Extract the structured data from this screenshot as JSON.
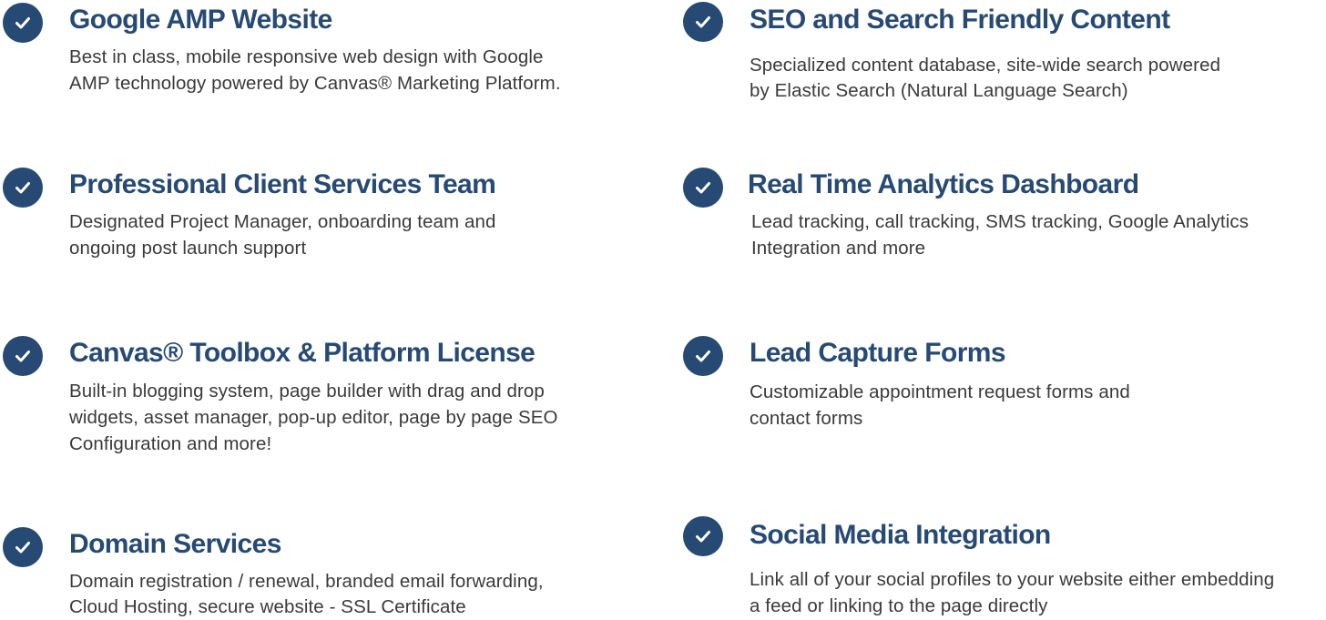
{
  "brand": {
    "accent": "#264a73",
    "text": "#3a3a3a",
    "check_icon": "checkmark-circle-icon"
  },
  "features": [
    {
      "title": "Google AMP Website",
      "lines": [
        "Best in class, mobile responsive web design with Google",
        "AMP technology powered by Canvas® Marketing Platform."
      ]
    },
    {
      "title": "SEO and Search Friendly Content",
      "lines": [
        "Specialized content database, site-wide search powered",
        "by Elastic Search (Natural Language Search)"
      ]
    },
    {
      "title": "Professional Client Services Team",
      "lines": [
        "Designated Project Manager, onboarding team and",
        "ongoing post launch support"
      ]
    },
    {
      "title": "Real Time Analytics Dashboard",
      "lines": [
        "Lead tracking, call tracking, SMS tracking, Google Analytics",
        "Integration and more"
      ]
    },
    {
      "title": "Canvas® Toolbox & Platform License",
      "lines": [
        "Built-in blogging system, page builder with drag and drop",
        "widgets, asset manager, pop-up editor, page by page SEO",
        "Configuration and more!"
      ]
    },
    {
      "title": "Lead Capture Forms",
      "lines": [
        "Customizable appointment request forms and",
        "contact forms"
      ]
    },
    {
      "title": "Domain Services",
      "lines": [
        "Domain registration / renewal, branded email forwarding,",
        "Cloud Hosting, secure website - SSL Certificate"
      ]
    },
    {
      "title": "Social Media Integration",
      "lines": [
        "Link all of your social profiles to your website either embedding",
        "a feed or linking to the page directly"
      ]
    }
  ]
}
